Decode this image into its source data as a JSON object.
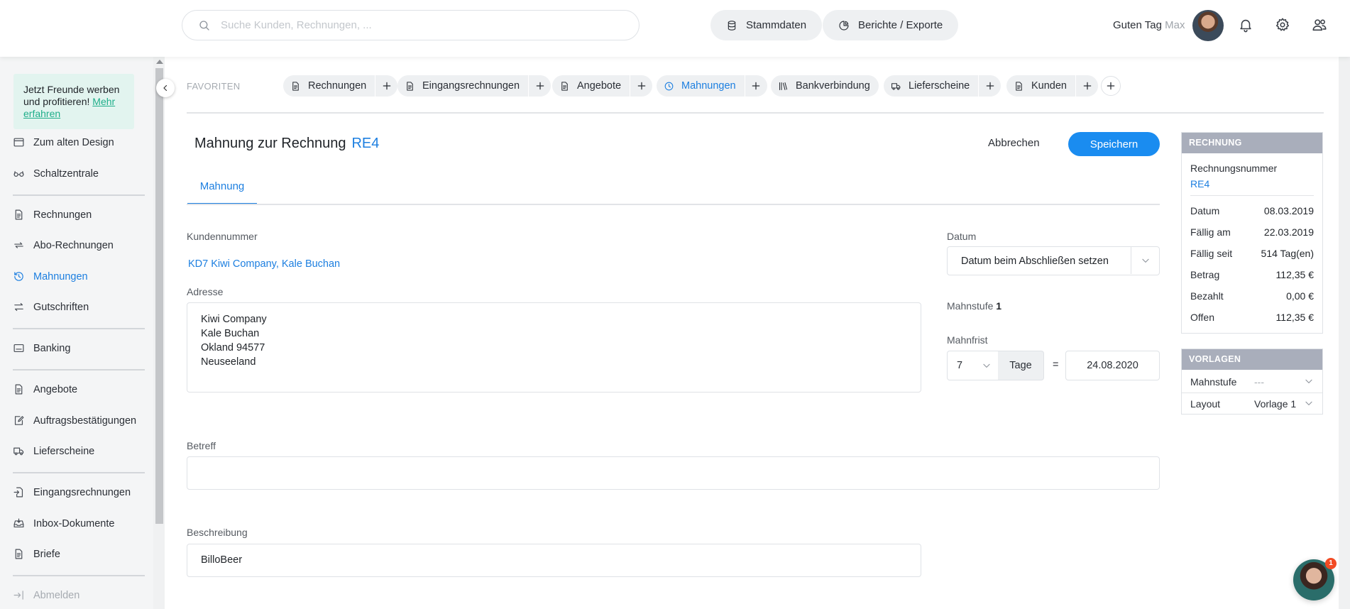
{
  "search": {
    "placeholder": "Suche Kunden, Rechnungen, ..."
  },
  "header": {
    "master_data": "Stammdaten",
    "reports": "Berichte / Exporte",
    "greeting": "Guten Tag",
    "user_name": "Max"
  },
  "sidebar": {
    "promo_text": "Jetzt Freunde werben und profitieren!",
    "promo_link": "Mehr erfahren",
    "items": [
      {
        "label": "Zum alten Design"
      },
      {
        "label": "Schaltzentrale"
      },
      {
        "label": "Rechnungen"
      },
      {
        "label": "Abo-Rechnungen"
      },
      {
        "label": "Mahnungen"
      },
      {
        "label": "Gutschriften"
      },
      {
        "label": "Banking"
      },
      {
        "label": "Angebote"
      },
      {
        "label": "Auftragsbestätigungen"
      },
      {
        "label": "Lieferscheine"
      },
      {
        "label": "Eingangsrechnungen"
      },
      {
        "label": "Inbox-Dokumente"
      },
      {
        "label": "Briefe"
      },
      {
        "label": "Abmelden"
      }
    ]
  },
  "favorites": {
    "label": "FAVORITEN",
    "items": [
      {
        "label": "Rechnungen"
      },
      {
        "label": "Eingangsrechnungen"
      },
      {
        "label": "Angebote"
      },
      {
        "label": "Mahnungen"
      },
      {
        "label": "Bankverbindung"
      },
      {
        "label": "Lieferscheine"
      },
      {
        "label": "Kunden"
      }
    ]
  },
  "page": {
    "title": "Mahnung zur Rechnung",
    "invoice_ref": "RE4",
    "cancel": "Abbrechen",
    "save": "Speichern",
    "tab": "Mahnung"
  },
  "form": {
    "customer_label": "Kundennummer",
    "customer_value": "KD7 Kiwi Company, Kale Buchan",
    "address_label": "Adresse",
    "address_lines": [
      "Kiwi Company",
      "Kale Buchan",
      "Okland 94577",
      "Neuseeland"
    ],
    "date_label": "Datum",
    "date_value": "Datum beim Abschließen setzen",
    "level_label": "Mahnstufe",
    "level_value": "1",
    "deadline_label": "Mahnfrist",
    "deadline_days": "7",
    "deadline_unit": "Tage",
    "equals": "=",
    "deadline_date": "24.08.2020",
    "subject_label": "Betreff",
    "subject_value": "",
    "description_label": "Beschreibung",
    "description_value": "BilloBeer"
  },
  "invoice_panel": {
    "title": "RECHNUNG",
    "number_label": "Rechnungsnummer",
    "number_value": "RE4",
    "rows": [
      {
        "k": "Datum",
        "v": "08.03.2019"
      },
      {
        "k": "Fällig am",
        "v": "22.03.2019"
      },
      {
        "k": "Fällig seit",
        "v": "514 Tag(en)"
      },
      {
        "k": "Betrag",
        "v": "112,35 €"
      },
      {
        "k": "Bezahlt",
        "v": "0,00 €"
      },
      {
        "k": "Offen",
        "v": "112,35 €"
      }
    ]
  },
  "templates_panel": {
    "title": "VORLAGEN",
    "level_label": "Mahnstufe",
    "level_value": "---",
    "layout_label": "Layout",
    "layout_value": "Vorlage 1"
  },
  "chat": {
    "badge": "1"
  },
  "colors": {
    "accent": "#1a8cf0",
    "promo_bg": "#e2f4ef",
    "panel_head": "#a9aebb"
  }
}
